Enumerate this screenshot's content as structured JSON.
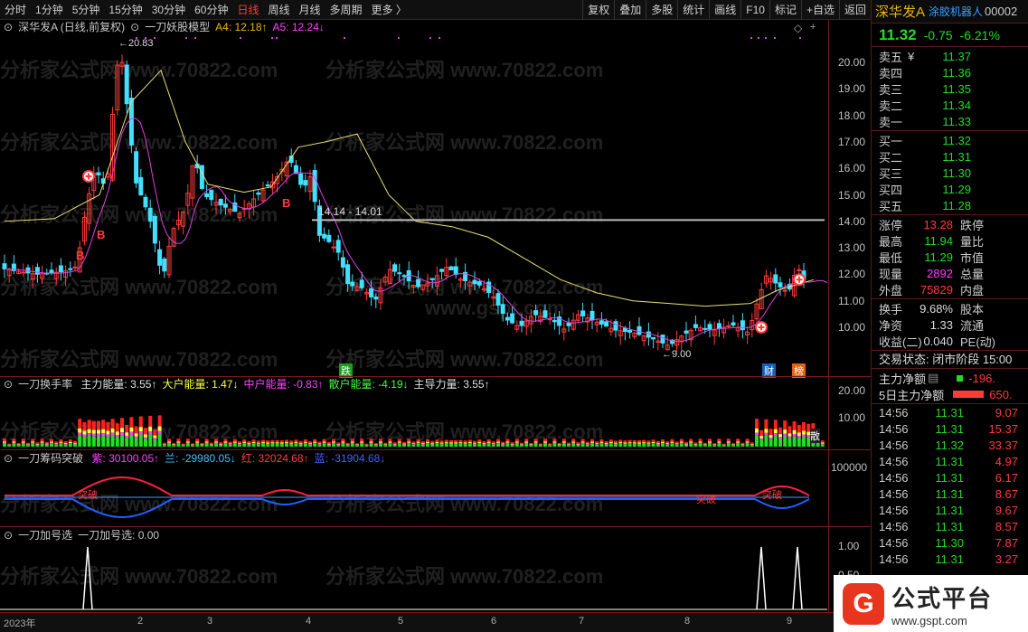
{
  "toolbar": {
    "periods": [
      "分时",
      "1分钟",
      "5分钟",
      "15分钟",
      "30分钟",
      "60分钟",
      "日线",
      "周线",
      "月线",
      "多周期",
      "更多 〉"
    ],
    "active_period": "日线",
    "actions": [
      "复权",
      "叠加",
      "多股",
      "统计",
      "画线",
      "F10",
      "标记",
      "+自选",
      "返回"
    ]
  },
  "main_panel": {
    "title": "深华发A (日线,前复权)",
    "model": "一刀妖股模型",
    "a4": "A4: 12.18↑",
    "a5": "A5: 12.24↓",
    "high_label": "←20.83",
    "low_label": "←9.00",
    "hline_label": "14.14 - 14.01",
    "b_mark": "B",
    "die_mark": "跌",
    "cai_mark": "财",
    "bang_mark": "榜",
    "y_ticks": [
      "20.00",
      "19.00",
      "18.00",
      "17.00",
      "16.00",
      "15.00",
      "14.00",
      "13.00",
      "12.00",
      "11.00",
      "10.00"
    ]
  },
  "vol_panel": {
    "name": "一刀换手率",
    "items": [
      {
        "text": "主力能量: 3.55↑",
        "color": "#e0e0e0"
      },
      {
        "text": "大户能量: 1.47↓",
        "color": "#ffff40"
      },
      {
        "text": "中户能量: -0.83↑",
        "color": "#ff40ff"
      },
      {
        "text": "散户能量: -4.19↓",
        "color": "#40ff40"
      },
      {
        "text": "主导力量: 3.55↑",
        "color": "#e0e0e0"
      }
    ],
    "y_ticks": [
      "20.00",
      "10.00"
    ],
    "side_mark": "散"
  },
  "chip_panel": {
    "name": "一刀筹码突破",
    "items": [
      {
        "text": "紫: 30100.05↑",
        "color": "#ff40ff"
      },
      {
        "text": "兰: -29980.05↓",
        "color": "#40c0ff"
      },
      {
        "text": "红: 32024.68↑",
        "color": "#ff4040"
      },
      {
        "text": "蓝: -31904.68↓",
        "color": "#4060ff"
      }
    ],
    "y_tick": "100000",
    "tupo_label": "突破"
  },
  "jiahao_panel": {
    "name": "一刀加号选",
    "value": "一刀加号选: 0.00",
    "y_ticks": [
      "1.00",
      "0.50"
    ]
  },
  "x_labels": [
    "2023年",
    "2",
    "3",
    "4",
    "5",
    "6",
    "7",
    "8",
    "9"
  ],
  "quote": {
    "name": "深华发A",
    "tag": "涂胶机器人",
    "code": "00002",
    "price": "11.32",
    "change": "-0.75",
    "pct": "-6.21%",
    "asks": [
      {
        "label": "卖五",
        "yen": "¥",
        "price": "11.37"
      },
      {
        "label": "卖四",
        "price": "11.36"
      },
      {
        "label": "卖三",
        "price": "11.35"
      },
      {
        "label": "卖二",
        "price": "11.34"
      },
      {
        "label": "卖一",
        "price": "11.33"
      }
    ],
    "bids": [
      {
        "label": "买一",
        "price": "11.32"
      },
      {
        "label": "买二",
        "price": "11.31"
      },
      {
        "label": "买三",
        "price": "11.30"
      },
      {
        "label": "买四",
        "price": "11.29"
      },
      {
        "label": "买五",
        "price": "11.28"
      }
    ],
    "stats1": [
      {
        "a": "涨停",
        "b": "13.28",
        "bc": "red",
        "c": "跌停"
      },
      {
        "a": "最高",
        "b": "11.94",
        "bc": "green",
        "c": "量比"
      },
      {
        "a": "最低",
        "b": "11.29",
        "bc": "green",
        "c": "市值"
      },
      {
        "a": "现量",
        "b": "2892",
        "bc": "mag",
        "c": "总量"
      },
      {
        "a": "外盘",
        "b": "75829",
        "bc": "red",
        "c": "内盘"
      }
    ],
    "stats2": [
      {
        "a": "换手",
        "b": "9.68%",
        "bc": "white",
        "c": "股本"
      },
      {
        "a": "净资",
        "b": "1.33",
        "bc": "white",
        "c": "流通"
      },
      {
        "a": "收益(二)",
        "b": "0.040",
        "bc": "white",
        "c": "PE(动)"
      }
    ],
    "status": "交易状态: 闭市阶段 15:00",
    "flow1_label": "主力净额",
    "flow1_val": "-196.",
    "flow2_label": "5日主力净额",
    "flow2_val": "650.",
    "ticks": [
      {
        "t": "14:56",
        "p": "11.31",
        "v": "9.07"
      },
      {
        "t": "14:56",
        "p": "11.31",
        "v": "15.37"
      },
      {
        "t": "14:56",
        "p": "11.32",
        "v": "33.37"
      },
      {
        "t": "14:56",
        "p": "11.31",
        "v": "4.97"
      },
      {
        "t": "14:56",
        "p": "11.31",
        "v": "6.17"
      },
      {
        "t": "14:56",
        "p": "11.31",
        "v": "8.67"
      },
      {
        "t": "14:56",
        "p": "11.31",
        "v": "9.67"
      },
      {
        "t": "14:56",
        "p": "11.31",
        "v": "8.57"
      },
      {
        "t": "14:56",
        "p": "11.30",
        "v": "7.87"
      },
      {
        "t": "14:56",
        "p": "11.31",
        "v": "3.27"
      }
    ]
  },
  "watermark": "分析家公式网 www.70822.com",
  "watermark2": "www.gspt.com",
  "logo": {
    "badge": "G",
    "title": "公式平台",
    "url": "www.gspt.com"
  }
}
